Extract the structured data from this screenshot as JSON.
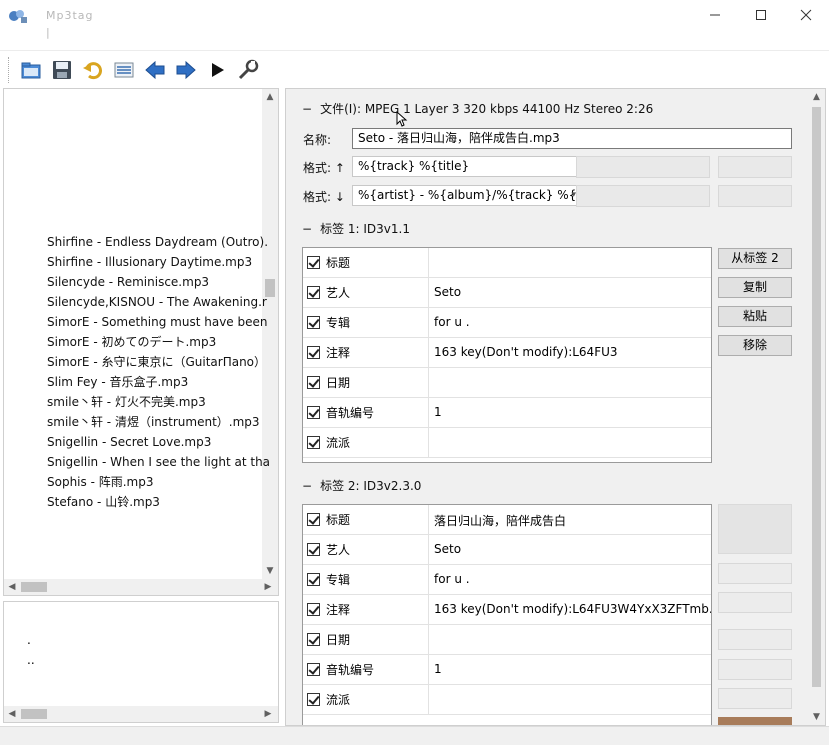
{
  "window": {
    "title": "Mp3tag",
    "subtitle": "|"
  },
  "toolbar": {
    "buttons": [
      "open-folder",
      "save",
      "undo",
      "tag-sources",
      "prev",
      "next",
      "play",
      "options"
    ]
  },
  "file_list": {
    "items": [
      "Shirfine - Endless Daydream (Outro).",
      "Shirfine - Illusionary Daytime.mp3",
      "Silencyde - Reminisce.mp3",
      "Silencyde,KISNOU - The Awakening.r",
      "SimorE - Something must have been",
      "SimorE - 初めてのデート.mp3",
      "SimorE - 糸守に東京に（GuitarΠano）",
      "Slim Fey - 音乐盒子.mp3",
      "smile丶轩 - 灯火不完美.mp3",
      "smile丶轩 - 清煜（instrument）.mp3",
      "Snigellin - Secret Love.mp3",
      "Snigellin - When I see the light at tha",
      "Sophis - 阵雨.mp3",
      "Stefano - 山铃.mp3"
    ]
  },
  "dir_list": {
    "items": [
      ".",
      ".."
    ]
  },
  "file_info": {
    "line": "文件(I): MPEG 1 Layer 3 320 kbps 44100 Hz Stereo 2:26"
  },
  "name_field": {
    "label": "名称:",
    "value": "Seto - 落日归山海，陪伴成告白.mp3"
  },
  "format1": {
    "label": "格式: ↑",
    "value": "%{track} %{title}"
  },
  "format2": {
    "label": "格式: ↓",
    "value": "%{artist} - %{album}/%{track} %{title}"
  },
  "tag1": {
    "heading": "标签 1: ID3v1.1",
    "rows": [
      {
        "name": "标题",
        "value": ""
      },
      {
        "name": "艺人",
        "value": "Seto"
      },
      {
        "name": "专辑",
        "value": "for u ."
      },
      {
        "name": "注释",
        "value": "163 key(Don't modify):L64FU3"
      },
      {
        "name": "日期",
        "value": ""
      },
      {
        "name": "音轨编号",
        "value": "1"
      },
      {
        "name": "流派",
        "value": ""
      }
    ],
    "buttons": [
      "从标签 2",
      "复制",
      "粘贴",
      "移除"
    ]
  },
  "tag2": {
    "heading": "标签 2: ID3v2.3.0",
    "rows": [
      {
        "name": "标题",
        "value": "落日归山海，陪伴成告白"
      },
      {
        "name": "艺人",
        "value": "Seto"
      },
      {
        "name": "专辑",
        "value": "for u ."
      },
      {
        "name": "注释",
        "value": "163 key(Don't modify):L64FU3W4YxX3ZFTmb..."
      },
      {
        "name": "日期",
        "value": ""
      },
      {
        "name": "音轨编号",
        "value": "1"
      },
      {
        "name": "流派",
        "value": ""
      }
    ]
  },
  "colors": {
    "accent": "#2a6fc4",
    "panel_bg": "#f0f0f0"
  }
}
